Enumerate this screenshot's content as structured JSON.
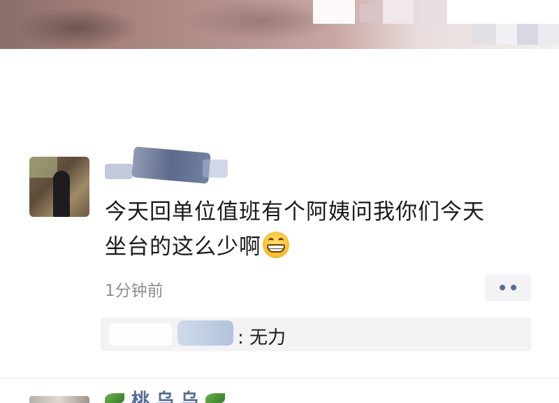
{
  "post": {
    "text_line1": "今天回单位值班有个阿姨问我你们今天",
    "text_line2": "坐台的这么少啊",
    "emoji": "grinning-face-emoji",
    "time": "1分钟前",
    "more_icon": "two-dots-icon"
  },
  "comment": {
    "text": ": 无力"
  },
  "next_post": {
    "name_visible": "桃 乌 乌",
    "icon": "leaf-icon"
  },
  "colors": {
    "link_blue": "#576b95",
    "time_gray": "#8e8e8e",
    "comment_bg": "#f3f3f5"
  }
}
